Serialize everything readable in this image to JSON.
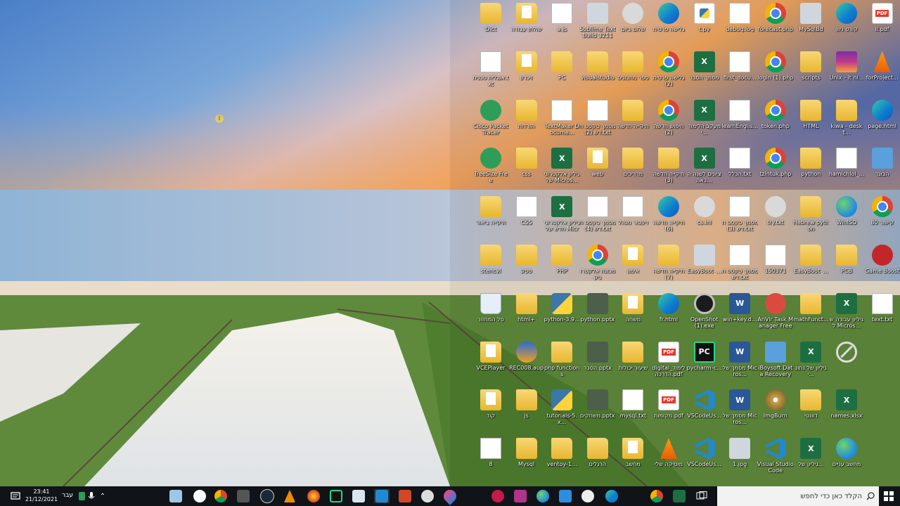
{
  "taskbar": {
    "clock_time": "23:41",
    "clock_date": "21/12/2021",
    "language": "עבר",
    "search_placeholder": "הקלד כאן כדי לחפש",
    "pinned": [
      "edge-legacy",
      "chrome-beta",
      "taskmgr",
      "steam",
      "globe",
      "vlc",
      "sublime",
      "pycharm",
      "settings",
      "vscode",
      "powerpoint",
      "obs",
      "drop",
      "raspberry",
      "pink-app",
      "globe2",
      "photos",
      "gamepad",
      "edge",
      "chrome",
      "excel",
      "notepad"
    ]
  },
  "cursor_glyph": "I",
  "desktop_icons": [
    {
      "label": "ll.pdf",
      "kind": "pdf",
      "col": 11,
      "row": 0
    },
    {
      "label": "קורס ניוון",
      "kind": "edge",
      "col": 10,
      "row": 0
    },
    {
      "label": "MySqlBd",
      "kind": "generic",
      "col": 9,
      "row": 0
    },
    {
      "label": "forecast.php",
      "kind": "chrome",
      "col": 8,
      "row": 0
    },
    {
      "label": "debug.log",
      "kind": "doc",
      "col": 7,
      "row": 0
    },
    {
      "label": "t.py",
      "kind": "py",
      "col": 6,
      "row": 0
    },
    {
      "label": "גלישה פרטית",
      "kind": "edge",
      "col": 5,
      "row": 0
    },
    {
      "label": "שלום ביום",
      "kind": "settings",
      "col": 4,
      "row": 0
    },
    {
      "label": "Sublime Text Build 3211 ...",
      "kind": "generic",
      "col": 3,
      "row": 0
    },
    {
      "label": "a.js",
      "kind": "doc",
      "col": 2,
      "row": 0
    },
    {
      "label": "שולחן עבודה",
      "kind": "folderdoc",
      "col": 1,
      "row": 0
    },
    {
      "label": "Dict",
      "kind": "folder",
      "col": 0,
      "row": 0
    },
    {
      "label": "forProject...",
      "kind": "vlc",
      "col": 11,
      "row": 1
    },
    {
      "label": "Unix - it ni...",
      "kind": "winrar",
      "col": 10,
      "row": 1
    },
    {
      "label": "scripts",
      "kind": "folder",
      "col": 9,
      "row": 1
    },
    {
      "label": "login (1).php",
      "kind": "chrome",
      "col": 8,
      "row": 1
    },
    {
      "label": "first_docu...",
      "kind": "doc",
      "col": 7,
      "row": 1
    },
    {
      "label": "מסמך הסבר",
      "kind": "excel",
      "col": 6,
      "row": 1
    },
    {
      "label": "גלישה פרטית (2)",
      "kind": "chrome",
      "col": 5,
      "row": 1
    },
    {
      "label": "ספר מתכונים",
      "kind": "folder",
      "col": 4,
      "row": 1
    },
    {
      "label": "visualstudio",
      "kind": "folder",
      "col": 3,
      "row": 1
    },
    {
      "label": "PC",
      "kind": "folder",
      "col": 2,
      "row": 1
    },
    {
      "label": "זיכרון",
      "kind": "folderdoc",
      "col": 1,
      "row": 1
    },
    {
      "label": "אנגלית טכנית.txt",
      "kind": "doc",
      "col": 0,
      "row": 1
    },
    {
      "label": "page.html",
      "kind": "edge",
      "col": 11,
      "row": 2
    },
    {
      "label": "kiwa - deskt...",
      "kind": "folder",
      "col": 10,
      "row": 2
    },
    {
      "label": "HTML",
      "kind": "folder",
      "col": 9,
      "row": 2
    },
    {
      "label": "token.php",
      "kind": "chrome",
      "col": 8,
      "row": 2
    },
    {
      "label": "learnEnglis...",
      "kind": "doc",
      "col": 7,
      "row": 2
    },
    {
      "label": "מעקב הלימודי...",
      "kind": "excel",
      "col": 6,
      "row": 2
    },
    {
      "label": "חיפוש חדשה (2)",
      "kind": "chrome",
      "col": 5,
      "row": 2
    },
    {
      "label": "תיקייה חדשה",
      "kind": "folder",
      "col": 4,
      "row": 2
    },
    {
      "label": "מסמך טקסט חדש (2).txt",
      "kind": "doc",
      "col": 3,
      "row": 2
    },
    {
      "label": "TextMaker Docume...",
      "kind": "doc",
      "col": 2,
      "row": 2
    },
    {
      "label": "הורדות",
      "kind": "folder",
      "col": 1,
      "row": 2
    },
    {
      "label": "Cisco Packet Tracer",
      "kind": "green",
      "col": 0,
      "row": 2
    },
    {
      "label": "הבוגר",
      "kind": "contact",
      "col": 11,
      "row": 3
    },
    {
      "label": "hamichlol_...",
      "kind": "doc",
      "col": 10,
      "row": 3
    },
    {
      "label": "python",
      "kind": "folder",
      "col": 9,
      "row": 3
    },
    {
      "label": "tzintuk.php",
      "kind": "chrome",
      "col": 8,
      "row": 3
    },
    {
      "label": "הכלל.txt",
      "kind": "doc",
      "col": 7,
      "row": 3
    },
    {
      "label": "ציונים לשנה הבאה...",
      "kind": "excel",
      "col": 6,
      "row": 3
    },
    {
      "label": "תיקייה חדשה (3)",
      "kind": "folder",
      "col": 5,
      "row": 3
    },
    {
      "label": "מדריכים",
      "kind": "folder",
      "col": 4,
      "row": 3
    },
    {
      "label": "web",
      "kind": "folderdoc",
      "col": 3,
      "row": 3
    },
    {
      "label": "גיליון אלקטרוני של Micros...",
      "kind": "excel",
      "col": 2,
      "row": 3
    },
    {
      "label": "css",
      "kind": "folder",
      "col": 1,
      "row": 3
    },
    {
      "label": "TreeSize Free",
      "kind": "green",
      "col": 0,
      "row": 3
    },
    {
      "label": "קישור 80",
      "kind": "chrome",
      "col": 11,
      "row": 4
    },
    {
      "label": "WinISO",
      "kind": "blueglobe",
      "col": 10,
      "row": 4
    },
    {
      "label": "Hebrew python",
      "kind": "folder",
      "col": 9,
      "row": 4
    },
    {
      "label": "try.txt",
      "kind": "settings",
      "col": 8,
      "row": 4
    },
    {
      "label": "מסמך טקסט חדש (3).txt",
      "kind": "doc",
      "col": 7,
      "row": 4
    },
    {
      "label": "cs.ini",
      "kind": "settings",
      "col": 6,
      "row": 4
    },
    {
      "label": "תיקייה חדשה (6)",
      "kind": "edge",
      "col": 5,
      "row": 4
    },
    {
      "label": "ויקטור מנהל",
      "kind": "doc",
      "col": 4,
      "row": 4
    },
    {
      "label": "מסמך טקסט חדש (4).txt",
      "kind": "doc",
      "col": 3,
      "row": 4
    },
    {
      "label": "גיליון אלקטרוני חדש של Micros...",
      "kind": "excel",
      "col": 2,
      "row": 4
    },
    {
      "label": "CSS",
      "kind": "doc",
      "col": 1,
      "row": 4
    },
    {
      "label": "תיקייה ביאור",
      "kind": "folder",
      "col": 0,
      "row": 4
    },
    {
      "label": "Game Boost",
      "kind": "red",
      "col": 11,
      "row": 5
    },
    {
      "label": "PCB",
      "kind": "folder",
      "col": 10,
      "row": 5
    },
    {
      "label": "EasyBoot_...",
      "kind": "folder",
      "col": 9,
      "row": 5
    },
    {
      "label": "150371",
      "kind": "doc",
      "col": 8,
      "row": 5
    },
    {
      "label": "מסמך טקסט חדש.txt",
      "kind": "doc",
      "col": 7,
      "row": 5
    },
    {
      "label": "EasyBoot_...",
      "kind": "generic",
      "col": 6,
      "row": 5
    },
    {
      "label": "תיקייה חדשה (7)",
      "kind": "folder",
      "col": 5,
      "row": 5
    },
    {
      "label": "אימון",
      "kind": "folderdoc",
      "col": 4,
      "row": 5
    },
    {
      "label": "מכונת אלקטרוניק",
      "kind": "chrome",
      "col": 3,
      "row": 5
    },
    {
      "label": "PHP",
      "kind": "folder",
      "col": 2,
      "row": 5
    },
    {
      "label": "ספק",
      "kind": "folder",
      "col": 1,
      "row": 5
    },
    {
      "label": "stencyl",
      "kind": "folder",
      "col": 0,
      "row": 5
    },
    {
      "label": "text.txt",
      "kind": "doc",
      "col": 11,
      "row": 6
    },
    {
      "label": "גיליון עבודה של Micros...",
      "kind": "excel",
      "col": 10,
      "row": 6
    },
    {
      "label": "mathFunct...",
      "kind": "folder",
      "col": 9,
      "row": 6
    },
    {
      "label": "AnVir Task Manager Free",
      "kind": "vcexe",
      "col": 8,
      "row": 6
    },
    {
      "label": "win+key.d...",
      "kind": "word",
      "col": 7,
      "row": 6
    },
    {
      "label": "OpenShot (1).exe",
      "kind": "gpu",
      "col": 6,
      "row": 6
    },
    {
      "label": "fr.html",
      "kind": "edge",
      "col": 5,
      "row": 6
    },
    {
      "label": "משחה",
      "kind": "folderdoc",
      "col": 4,
      "row": 6
    },
    {
      "label": "python.pptx",
      "kind": "pptdoc",
      "col": 3,
      "row": 6
    },
    {
      "label": "python-3.9...",
      "kind": "python",
      "col": 2,
      "row": 6
    },
    {
      "label": "html+",
      "kind": "folder",
      "col": 1,
      "row": 6
    },
    {
      "label": "סל המחזור",
      "kind": "bin",
      "col": 0,
      "row": 6
    },
    {
      "label": "",
      "kind": "blocked",
      "col": 10,
      "row": 7
    },
    {
      "label": "גיליון של נתוני...",
      "kind": "excel",
      "col": 9,
      "row": 7
    },
    {
      "label": "iBoysoft Data Recovery",
      "kind": "contact",
      "col": 8,
      "row": 7
    },
    {
      "label": "מסמך של Micros...",
      "kind": "word",
      "col": 7,
      "row": 7
    },
    {
      "label": "pycharm-c...",
      "kind": "pycharm",
      "col": 6,
      "row": 7
    },
    {
      "label": "digital_לימוד הדרכה.pdf",
      "kind": "pdf",
      "col": 5,
      "row": 7
    },
    {
      "label": "שיעור יכולות",
      "kind": "folder",
      "col": 4,
      "row": 7
    },
    {
      "label": "הסבר.pptx",
      "kind": "pptdoc",
      "col": 3,
      "row": 7
    },
    {
      "label": "php functions",
      "kind": "folder",
      "col": 2,
      "row": 7
    },
    {
      "label": "REC008.aup",
      "kind": "audio",
      "col": 1,
      "row": 7
    },
    {
      "label": "VCEPlayer",
      "kind": "folderdoc",
      "col": 0,
      "row": 7
    },
    {
      "label": "names.xlsx",
      "kind": "excel",
      "col": 10,
      "row": 8
    },
    {
      "label": "דוונטי",
      "kind": "folder",
      "col": 9,
      "row": 8
    },
    {
      "label": "ImgBurn",
      "kind": "disc",
      "col": 8,
      "row": 8
    },
    {
      "label": "מסמך של Micros...",
      "kind": "word",
      "col": 7,
      "row": 8
    },
    {
      "label": "VSCodeUs...",
      "kind": "vscode",
      "col": 6,
      "row": 8
    },
    {
      "label": "מקומות.pdf",
      "kind": "pdf",
      "col": 5,
      "row": 8
    },
    {
      "label": "mysql.txt",
      "kind": "doc",
      "col": 4,
      "row": 8
    },
    {
      "label": "משחקים.pptx",
      "kind": "pptdoc",
      "col": 3,
      "row": 8
    },
    {
      "label": "tutorials-5.x...",
      "kind": "python",
      "col": 2,
      "row": 8
    },
    {
      "label": "js",
      "kind": "folder",
      "col": 1,
      "row": 8
    },
    {
      "label": "קוד",
      "kind": "folderdoc",
      "col": 0,
      "row": 8
    },
    {
      "label": "מחשב עניים",
      "kind": "blueglobe",
      "col": 10,
      "row": 9
    },
    {
      "label": "גיליון של...",
      "kind": "excel",
      "col": 9,
      "row": 9
    },
    {
      "label": "Visual Studio Code",
      "kind": "vscode",
      "col": 8,
      "row": 9
    },
    {
      "label": "1.jpg",
      "kind": "generic",
      "col": 7,
      "row": 9
    },
    {
      "label": "VSCodeUs...",
      "kind": "vscode",
      "col": 6,
      "row": 9
    },
    {
      "label": "מוסיקה שלי",
      "kind": "vlc",
      "col": 5,
      "row": 9
    },
    {
      "label": "מחשב",
      "kind": "folderdoc",
      "col": 4,
      "row": 9
    },
    {
      "label": "הרגלים",
      "kind": "folder",
      "col": 3,
      "row": 9
    },
    {
      "label": "ventoy-1...",
      "kind": "folder",
      "col": 2,
      "row": 9
    },
    {
      "label": "Mysql",
      "kind": "folder",
      "col": 1,
      "row": 9
    },
    {
      "label": "8",
      "kind": "doc",
      "col": 0,
      "row": 9
    }
  ]
}
